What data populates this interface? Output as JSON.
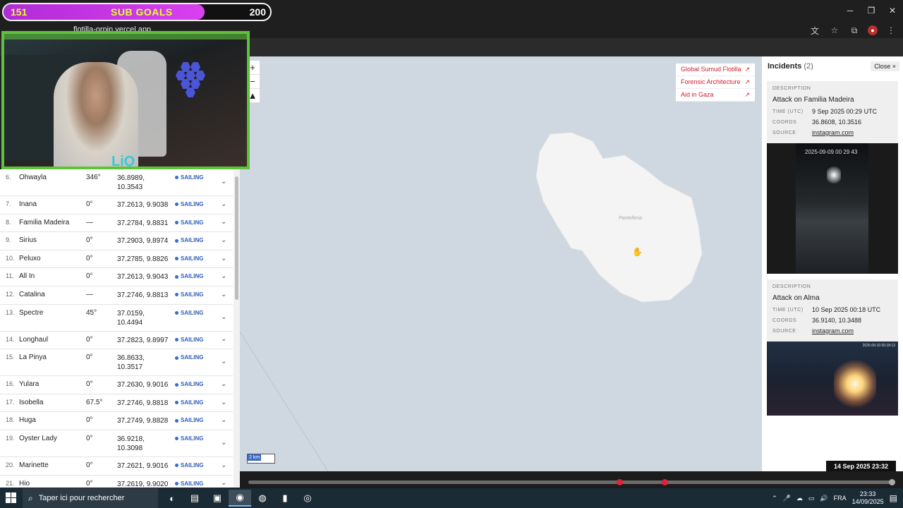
{
  "overlay": {
    "sub_goals": {
      "current": "151",
      "label": "SUB GOALS",
      "goal": "200",
      "progress": 0.755
    },
    "webcam_logo": "LiQ"
  },
  "browser": {
    "url": "flotilla-orpin.vercel.app",
    "window_controls": [
      "minimize-icon",
      "restore-icon",
      "close-icon"
    ]
  },
  "map": {
    "links": [
      {
        "label": "Global Sumud Flotilla",
        "icon": "external-link-icon"
      },
      {
        "label": "Forensic Architecture",
        "icon": "external-link-icon"
      },
      {
        "label": "Aid in Gaza",
        "icon": "external-link-icon"
      }
    ],
    "zoom_in": "+",
    "zoom_out": "−",
    "compass": "▲",
    "towns": [
      "Pantelleria"
    ],
    "scale_label": "2 km"
  },
  "vessels": [
    {
      "n": "6.",
      "name": "Ohwayla",
      "heading": "346°",
      "coords": "36.8989, 10.3543",
      "status": "SAILING"
    },
    {
      "n": "7.",
      "name": "Inana",
      "heading": "0°",
      "coords": "37.2613, 9.9038",
      "status": "SAILING"
    },
    {
      "n": "8.",
      "name": "Familia Madeira",
      "heading": "—",
      "coords": "37.2784, 9.8831",
      "status": "SAILING"
    },
    {
      "n": "9.",
      "name": "Sirius",
      "heading": "0°",
      "coords": "37.2903, 9.8974",
      "status": "SAILING"
    },
    {
      "n": "10.",
      "name": "Peluxo",
      "heading": "0°",
      "coords": "37.2785, 9.8826",
      "status": "SAILING"
    },
    {
      "n": "11.",
      "name": "All In",
      "heading": "0°",
      "coords": "37.2613, 9.9043",
      "status": "SAILING"
    },
    {
      "n": "12.",
      "name": "Catalina",
      "heading": "—",
      "coords": "37.2746, 9.8813",
      "status": "SAILING"
    },
    {
      "n": "13.",
      "name": "Spectre",
      "heading": "45°",
      "coords": "37.0159, 10.4494",
      "status": "SAILING"
    },
    {
      "n": "14.",
      "name": "Longhaul",
      "heading": "0°",
      "coords": "37.2823, 9.8997",
      "status": "SAILING"
    },
    {
      "n": "15.",
      "name": "La Pinya",
      "heading": "0°",
      "coords": "36.8633, 10.3517",
      "status": "SAILING"
    },
    {
      "n": "16.",
      "name": "Yulara",
      "heading": "0°",
      "coords": "37.2630, 9.9016",
      "status": "SAILING"
    },
    {
      "n": "17.",
      "name": "Isobella",
      "heading": "67.5°",
      "coords": "37.2746, 9.8818",
      "status": "SAILING"
    },
    {
      "n": "18.",
      "name": "Huga",
      "heading": "0°",
      "coords": "37.2749, 9.8828",
      "status": "SAILING"
    },
    {
      "n": "19.",
      "name": "Oyster Lady",
      "heading": "0°",
      "coords": "36.9218, 10.3098",
      "status": "SAILING"
    },
    {
      "n": "20.",
      "name": "Marinette",
      "heading": "0°",
      "coords": "37.2621, 9.9016",
      "status": "SAILING"
    },
    {
      "n": "21.",
      "name": "Hio",
      "heading": "0°",
      "coords": "37.2619, 9.9020",
      "status": "SAILING"
    }
  ],
  "incidents": {
    "title": "Incidents",
    "count": "(2)",
    "close_label": "Close ×",
    "labels": {
      "description": "DESCRIPTION",
      "time": "TIME (UTC)",
      "coords": "COORDS",
      "source": "SOURCE"
    },
    "items": [
      {
        "description": "Attack on Familia Madeira",
        "time": "9 Sep 2025 00:29 UTC",
        "coords": "36.8608, 10.3516",
        "source": "instagram.com",
        "image_timestamp": "2025-09-09 00 29 43"
      },
      {
        "description": "Attack on Alma",
        "time": "10 Sep 2025 00:18 UTC",
        "coords": "36.9140, 10.3488",
        "source": "instagram.com",
        "image_timestamp": "2025-09-10 00:18:13"
      }
    ]
  },
  "timeline": {
    "current": "14 Sep 2025 23:32",
    "incident_markers": [
      0.575,
      0.645
    ],
    "position": 1.0,
    "colors": {
      "marker": "#e0223a"
    }
  },
  "taskbar": {
    "search_placeholder": "Taper ici pour rechercher",
    "language": "FRA",
    "time": "23:33",
    "date": "14/09/2025"
  }
}
